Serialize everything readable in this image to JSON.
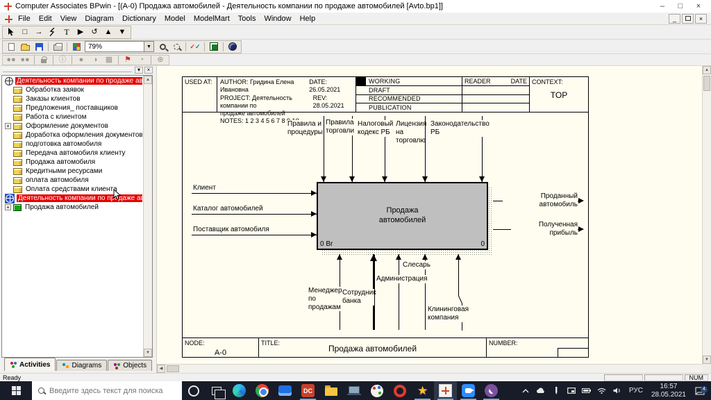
{
  "window": {
    "title": "Computer Associates BPwin - [(A-0) Продажа автомобилей - Деятельность компании по продаже автомобилей  [Avto.bp1]]",
    "minimize": "–",
    "maximize": "□",
    "close": "×"
  },
  "menu": {
    "items": [
      "File",
      "Edit",
      "View",
      "Diagram",
      "Dictionary",
      "Model",
      "ModelMart",
      "Tools",
      "Window",
      "Help"
    ]
  },
  "toolbar": {
    "zoom_value": "79%",
    "tool_icons": [
      "pointer-tool",
      "activity-box-tool",
      "arrow-tool",
      "squiggle-tool",
      "text-tool",
      "precedence-tool",
      "turn-tool",
      "go-up-tool",
      "go-down-tool"
    ],
    "std_icons": [
      "new-file",
      "open-file",
      "save-file",
      "print",
      "color-palette",
      "zoom-combo",
      "zoom-in",
      "zoom-area",
      "spell-check",
      "model-explorer-toggle",
      "modelmart-globe"
    ]
  },
  "explorer": {
    "tabs": [
      "Activities",
      "Diagrams",
      "Objects"
    ],
    "tree": [
      {
        "label": "Деятельность компании по продаже автомобилей",
        "icon": "model-compass",
        "root": true,
        "selected": false
      },
      {
        "label": "Обработка заявок",
        "icon": "activity"
      },
      {
        "label": "Заказы клиентов",
        "icon": "activity"
      },
      {
        "label": "Предложения_ поставщиков",
        "icon": "activity"
      },
      {
        "label": "Работа с клиентом",
        "icon": "activity"
      },
      {
        "label": "Оформление документов",
        "icon": "activity",
        "expander": "+"
      },
      {
        "label": "Доработка оформления документов",
        "icon": "activity"
      },
      {
        "label": "подготовка автомобиля",
        "icon": "activity"
      },
      {
        "label": "Передача автомобиля  клиенту",
        "icon": "activity"
      },
      {
        "label": "Продажа автомобиля",
        "icon": "activity"
      },
      {
        "label": "Кредитными  ресурсами",
        "icon": "activity"
      },
      {
        "label": "оплата  автомобиля",
        "icon": "activity"
      },
      {
        "label": "Оплата средствами клиента",
        "icon": "activity"
      },
      {
        "label": "Деятельность компании по продаже автомобилей",
        "icon": "model-compass",
        "root": true,
        "selected": true
      },
      {
        "label": "Продажа автомобилей",
        "icon": "diagram-green",
        "expander": "+"
      }
    ]
  },
  "diagram": {
    "header": {
      "used_at": "USED AT:",
      "author": "AUTHOR:  Гридина Елена Ивановна",
      "date_label": "DATE:",
      "date": "26.05.2021",
      "project1": "PROJECT:  Деятельность компании по",
      "rev_label": "REV:",
      "rev": "28.05.2021",
      "project2": "продаже автомобилей",
      "notes": "NOTES:  1  2  3  4  5  6  7  8  9  10",
      "statuses": [
        "WORKING",
        "DRAFT",
        "RECOMMENDED",
        "PUBLICATION"
      ],
      "reader": "READER",
      "reader_date": "DATE",
      "context_label": "CONTEXT:",
      "context": "TOP"
    },
    "activity": {
      "name": "Продажа\nавтомобилей",
      "cost": "0 Br",
      "number": "0"
    },
    "controls": [
      "Правила и процедуры",
      "Правила торговли",
      "Налоговый кодекс РБ",
      "Лицензия на торговлю",
      "Законодательство РБ"
    ],
    "inputs": [
      "Клиент",
      "Каталог автомобилей",
      "Поставщик автомобиля"
    ],
    "outputs": [
      "Проданный автомобиль",
      "Полученная прибыль"
    ],
    "mechanisms": [
      "Менеджер по продажам",
      "Сотрудник банка",
      "Администрация",
      "Слесарь",
      "Клининговая компания"
    ],
    "footer": {
      "node_label": "NODE:",
      "node": "A-0",
      "title_label": "TITLE:",
      "title": "Продажа автомобилей",
      "number_label": "NUMBER:"
    }
  },
  "statusbar": {
    "ready": "Ready",
    "num": "NUM"
  },
  "taskbar": {
    "search_placeholder": "Введите здесь текст для поиска",
    "language": "РУС",
    "time": "16:57",
    "date": "28.05.2021",
    "notification_count": "4",
    "app_icons": [
      "start",
      "search",
      "cortana",
      "task-view",
      "edge",
      "chrome",
      "mail-app",
      "red-app",
      "file-explorer",
      "laptop-app",
      "paint-app",
      "opera-app",
      "star-app",
      "bpwin",
      "zoom-app",
      "viber"
    ],
    "tray_icons": [
      "tray-expand",
      "onedrive-cloud",
      "pen",
      "cast-screen",
      "battery",
      "wifi",
      "volume",
      "language",
      "clock",
      "notifications"
    ]
  }
}
